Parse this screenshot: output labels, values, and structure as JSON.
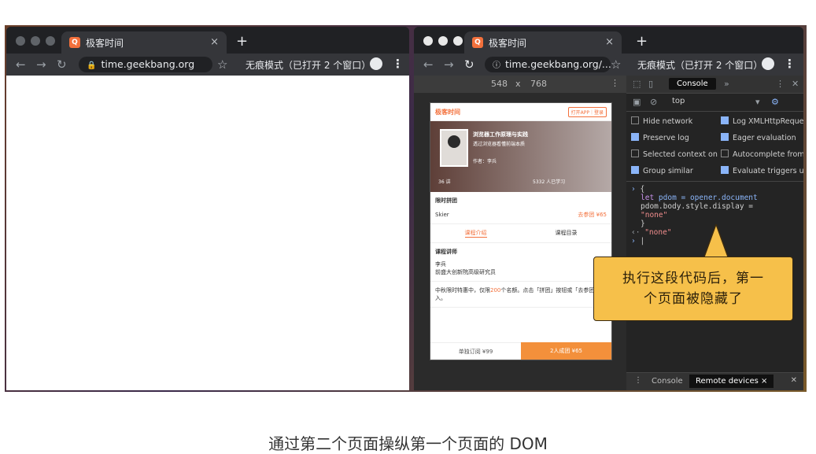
{
  "window1": {
    "tab_title": "极客时间",
    "tab_close": "×",
    "new_tab": "+",
    "url": "time.geekbang.org",
    "incognito_label": "无痕模式（已打开 2 个窗口）"
  },
  "window2": {
    "tab_title": "极客时间",
    "tab_close": "×",
    "new_tab": "+",
    "url": "time.geekbang.org/...",
    "incognito_label": "无痕模式（已打开 2 个窗口）",
    "device_width": "548",
    "device_x": "x",
    "device_height": "768",
    "phone": {
      "logo": "极客时间",
      "open_app": "打开APP｜登录",
      "course_title": "浏览器工作原理与实践",
      "course_sub": "透过浏览器看懂前端本质",
      "author_line": "作者：李兵",
      "lessons": "36 讲",
      "students": "5332 人已学习",
      "group_title": "限时拼团",
      "group_user": "Skier",
      "group_price": "去参团 ¥65",
      "tab_intro": "课程介绍",
      "tab_catalog": "课程目录",
      "lecturer_heading": "课程讲师",
      "lecturer_name": "李兵",
      "lecturer_title": "前盛大创新院高级研究员",
      "promo_text": "中秋限时特惠中，仅限",
      "promo_count": "200",
      "promo_text2": "个名额。点击「拼团」按钮或「去参团」加入。",
      "buy_single": "单独订阅 ¥99",
      "buy_group": "2人成团 ¥65"
    }
  },
  "devtools": {
    "console_tab": "Console",
    "context": "top",
    "options": {
      "hide_network": "Hide network",
      "log_xhr": "Log XMLHttpReque",
      "preserve_log": "Preserve log",
      "eager_eval": "Eager evaluation",
      "selected_context": "Selected context on",
      "autocomplete": "Autocomplete from h",
      "group_similar": "Group similar",
      "evaluate_triggers": "Evaluate triggers us"
    },
    "code_lines": {
      "l1": "{",
      "l2_kw": "let",
      "l2_var": "pdom",
      "l2_rest": " = opener.document",
      "l3": "pdom.body.style.display =",
      "l4": "\"none\"",
      "l5": "}",
      "result": "\"none\""
    },
    "bottom_console": "Console",
    "bottom_remote": "Remote devices ×"
  },
  "callout": {
    "line1": "执行这段代码后，第一",
    "line2": "个页面被隐藏了"
  },
  "caption": "通过第二个页面操纵第一个页面的 DOM",
  "colors": {
    "accent": "#f3703b",
    "callout_bg": "#f6c04a"
  }
}
